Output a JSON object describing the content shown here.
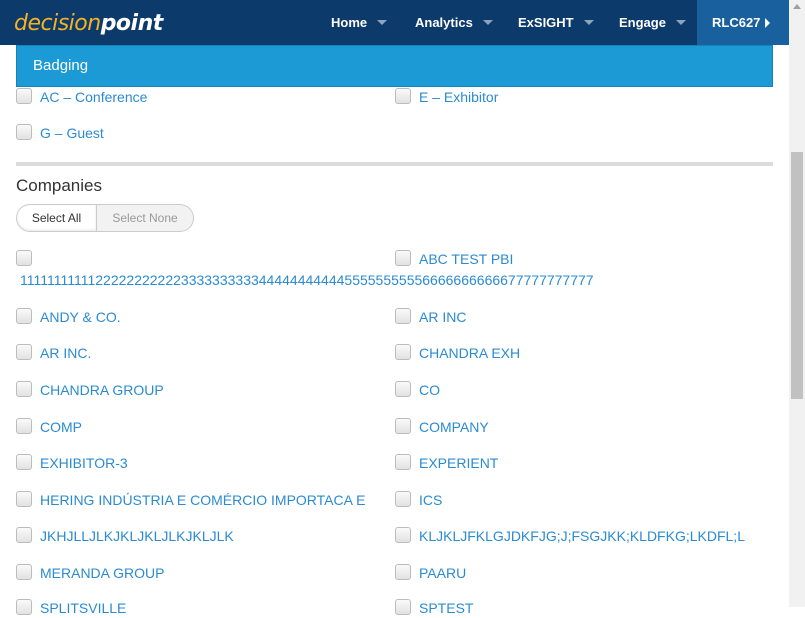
{
  "nav": {
    "logo_part1": "decision",
    "logo_part2": "point",
    "items": [
      {
        "label": "Home"
      },
      {
        "label": "Analytics"
      },
      {
        "label": "ExSIGHT"
      },
      {
        "label": "Engage"
      }
    ],
    "user": "RLC627"
  },
  "badging": {
    "title": "Badging",
    "options": [
      {
        "label": "AC – Conference",
        "checked": false
      },
      {
        "label": "E – Exhibitor",
        "checked": false
      },
      {
        "label": "G – Guest",
        "checked": false
      }
    ]
  },
  "companies": {
    "title": "Companies",
    "select_all": "Select All",
    "select_none": "Select None",
    "items": [
      {
        "label": "111111111112222222222233333333334444444444455555555556666666666677777777777"
      },
      {
        "label": "ABC TEST PBI"
      },
      {
        "label": "ANDY & CO."
      },
      {
        "label": "AR INC"
      },
      {
        "label": "AR INC."
      },
      {
        "label": "CHANDRA EXH"
      },
      {
        "label": "CHANDRA GROUP"
      },
      {
        "label": "CO"
      },
      {
        "label": "COMP"
      },
      {
        "label": "COMPANY"
      },
      {
        "label": "EXHIBITOR-3"
      },
      {
        "label": "EXPERIENT"
      },
      {
        "label": "HERING INDÚSTRIA E COMÉRCIO IMPORTACA E"
      },
      {
        "label": "ICS"
      },
      {
        "label": "JKHJLLJLKJKLJKLJLKJKLJLK"
      },
      {
        "label": "KLJKLJFKLGJDKFJG;J;FSGJKK;KLDFKG;LKDFL;L"
      },
      {
        "label": "MERANDA GROUP"
      },
      {
        "label": "PAARU"
      },
      {
        "label": "SPLITSVILLE"
      },
      {
        "label": "SPTEST"
      }
    ]
  }
}
